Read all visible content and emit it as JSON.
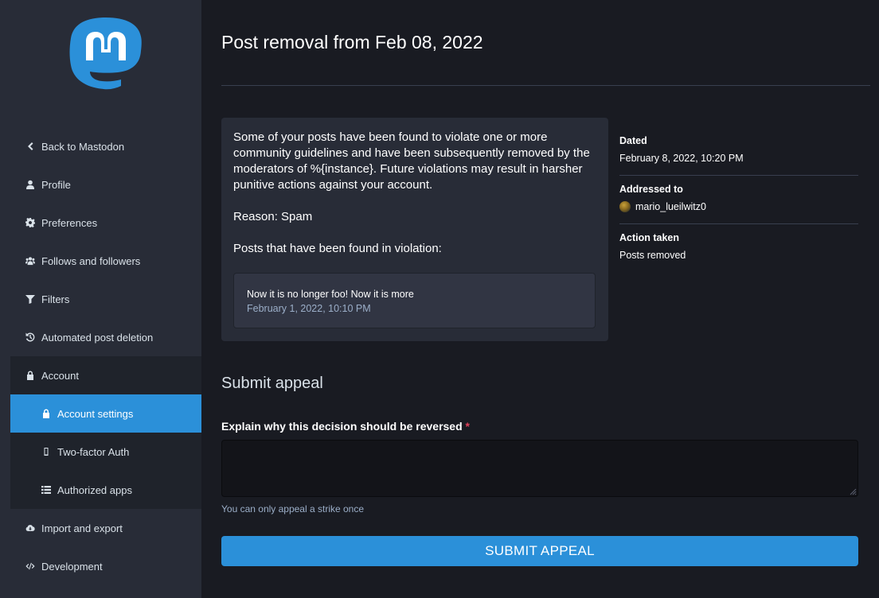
{
  "sidebar": {
    "items": [
      {
        "label": "Back to Mastodon",
        "icon": "chevron-left-icon"
      },
      {
        "label": "Profile",
        "icon": "user-icon"
      },
      {
        "label": "Preferences",
        "icon": "gear-icon"
      },
      {
        "label": "Follows and followers",
        "icon": "users-icon"
      },
      {
        "label": "Filters",
        "icon": "filter-icon"
      },
      {
        "label": "Automated post deletion",
        "icon": "history-icon"
      },
      {
        "label": "Account",
        "icon": "lock-icon"
      },
      {
        "label": "Account settings",
        "icon": "lock-icon"
      },
      {
        "label": "Two-factor Auth",
        "icon": "mobile-icon"
      },
      {
        "label": "Authorized apps",
        "icon": "list-icon"
      },
      {
        "label": "Import and export",
        "icon": "cloud-download-icon"
      },
      {
        "label": "Development",
        "icon": "code-icon"
      }
    ],
    "active": "Account settings"
  },
  "main": {
    "title": "Post removal from Feb 08, 2022",
    "strike": {
      "paragraph": "Some of your posts have been found to violate one or more community guidelines and have been subsequently removed by the moderators of %{instance}. Future violations may result in harsher punitive actions against your account.",
      "reason": "Reason: Spam",
      "posts_heading": "Posts that have been found in violation:",
      "post": {
        "text": "Now it is no longer foo! Now it is more",
        "date": "February 1, 2022, 10:10 PM"
      }
    },
    "meta": {
      "dated_label": "Dated",
      "dated_value": "February 8, 2022, 10:20 PM",
      "addressed_label": "Addressed to",
      "addressed_value": "mario_lueilwitz0",
      "action_label": "Action taken",
      "action_value": "Posts removed"
    },
    "appeal": {
      "section_title": "Submit appeal",
      "field_label": "Explain why this decision should be reversed",
      "required_mark": "*",
      "textarea_value": "",
      "hint": "You can only appeal a strike once",
      "submit_label": "SUBMIT APPEAL"
    }
  },
  "colors": {
    "accent": "#2b90d9",
    "sidebar_bg": "#282c37",
    "main_bg": "#191b22",
    "card_bg": "#282c37",
    "required": "#df405a"
  }
}
